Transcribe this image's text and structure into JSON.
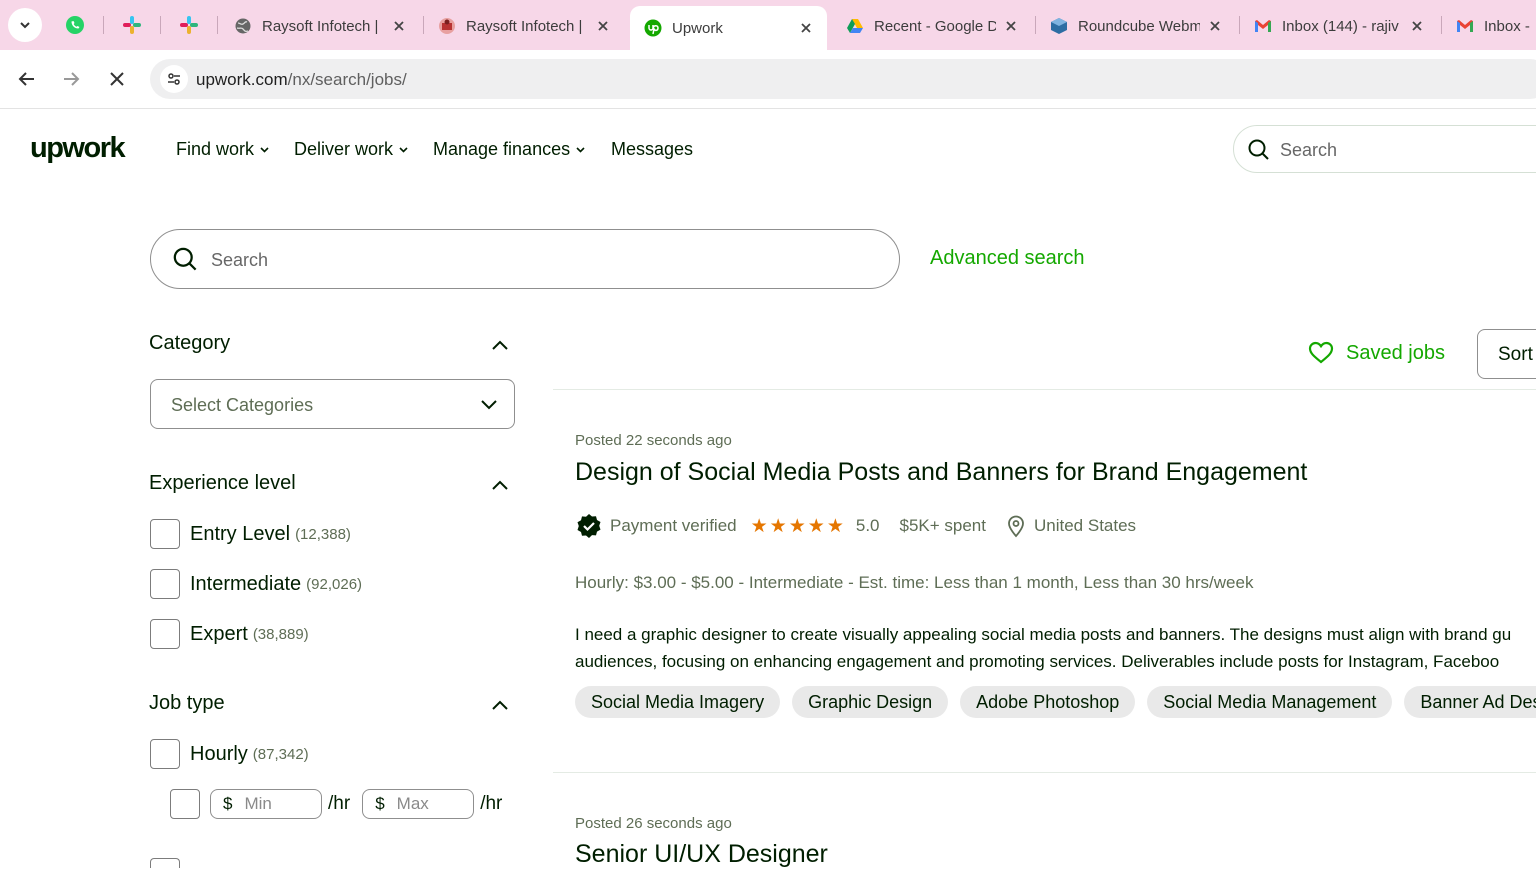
{
  "browser": {
    "tabs": [
      {
        "title": "Raysoft Infotech | ",
        "icon": "globe-icon"
      },
      {
        "title": "Raysoft Infotech | ",
        "icon": "raysoft-logo-icon"
      },
      {
        "title": "Upwork",
        "icon": "upwork-favicon-icon",
        "active": true
      },
      {
        "title": "Recent - Google D",
        "icon": "google-drive-icon"
      },
      {
        "title": "Roundcube Webm",
        "icon": "roundcube-icon"
      },
      {
        "title": "Inbox (144) - rajiv",
        "icon": "gmail-icon"
      },
      {
        "title": "Inbox - ",
        "icon": "gmail-icon"
      }
    ],
    "url_host": "upwork.com",
    "url_path": "/nx/search/jobs/"
  },
  "header": {
    "logo": "upwork",
    "nav": [
      "Find work",
      "Deliver work",
      "Manage finances",
      "Messages"
    ],
    "search_placeholder": "Search"
  },
  "search": {
    "placeholder": "Search",
    "advanced_label": "Advanced search"
  },
  "filters": {
    "category": {
      "title": "Category",
      "select_value": "Select Categories"
    },
    "experience": {
      "title": "Experience level",
      "options": [
        {
          "label": "Entry Level",
          "count": "(12,388)"
        },
        {
          "label": "Intermediate",
          "count": "(92,026)"
        },
        {
          "label": "Expert",
          "count": "(38,889)"
        }
      ]
    },
    "job_type": {
      "title": "Job type",
      "hourly_label": "Hourly",
      "hourly_count": "(87,342)",
      "currency": "$",
      "min_placeholder": "Min",
      "max_placeholder": "Max",
      "per_hour": "/hr"
    }
  },
  "jobs": {
    "saved_label": "Saved jobs",
    "sort_label": "Sort",
    "items": [
      {
        "posted": "Posted 22 seconds ago",
        "title": "Design of Social Media Posts and Banners for Brand Engagement",
        "payment": "Payment verified",
        "rating": "5.0",
        "stars": 5,
        "spent": "$5K+ spent",
        "location": "United States",
        "terms": "Hourly: $3.00 - $5.00 - Intermediate - Est. time: Less than 1 month, Less than 30 hrs/week",
        "desc_line1": "I need a graphic designer to create visually appealing social media posts and banners. The designs must align with brand gu",
        "desc_line2": "audiences, focusing on enhancing engagement and promoting services. Deliverables include posts for Instagram, Faceboo",
        "skills": [
          "Social Media Imagery",
          "Graphic Design",
          "Adobe Photoshop",
          "Social Media Management",
          "Banner Ad Des"
        ]
      },
      {
        "posted": "Posted 26 seconds ago",
        "title": "Senior UI/UX Designer"
      }
    ]
  }
}
